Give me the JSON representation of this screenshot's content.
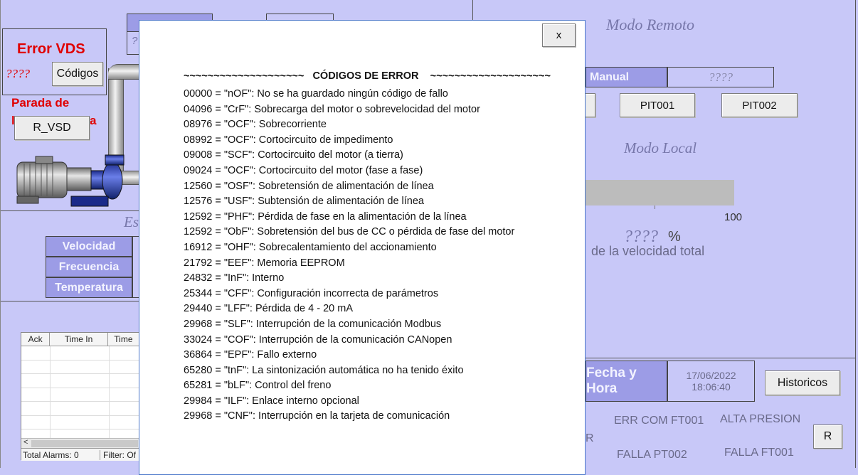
{
  "left_panel": {
    "error_title": "Error VDS",
    "error_value": "????",
    "codes_button": "Códigos",
    "stop_label_line1": "Parada de",
    "stop_label_partial": "a",
    "reset_vsd_button": "R_VSD",
    "top_box_partial": "?",
    "section_title_partial": "Es",
    "parameters": [
      {
        "label": "Velocidad"
      },
      {
        "label": "Frecuencia"
      },
      {
        "label": "Temperatura"
      }
    ]
  },
  "alarm_table": {
    "columns": [
      "Ack",
      "Time In",
      "Time"
    ],
    "scroll_left_glyph": "<",
    "total_alarms": "Total Alarms: 0",
    "filter_partial": "Filter: Of"
  },
  "right_panel": {
    "remote_mode_title": "Modo Remoto",
    "manual_label": "Manual",
    "manual_value": "????",
    "pit001_button": "PIT001",
    "pit002_button": "PIT002",
    "local_mode_title": "Modo Local",
    "scale_max": "100",
    "speed_value": "????",
    "speed_unit": "%",
    "speed_caption": "de la velocidad total",
    "speed_fraction": 0,
    "datetime_label": "Fecha y Hora",
    "date": "17/06/2022",
    "time": "18:06:40",
    "historicos_button": "Historicos",
    "alarm_err_com": "ERR COM FT001",
    "alarm_alta_presion": "ALTA PRESION",
    "alarm_partial": "R",
    "alarm_falla_pt002": "FALLA PT002",
    "alarm_falla_ft001": "FALLA FT001",
    "reset_button": "R"
  },
  "modal": {
    "close_label": "x",
    "title": "~~~~~~~~~~~~~~~~~~~~   CÓDIGOS DE ERROR    ~~~~~~~~~~~~~~~~~~~~",
    "codes": [
      "00000 = \"nOF\": No se ha guardado ningún código de fallo",
      "04096 = \"CrF\": Sobrecarga del motor o sobrevelocidad del motor",
      "08976 = \"OCF\": Sobrecorriente",
      "08992 = \"OCF\": Cortocircuito de impedimento",
      "09008 = \"SCF\": Cortocircuito del motor (a tierra)",
      "09024 = \"OCF\": Cortocircuito del motor (fase a fase)",
      "12560 = \"OSF\": Sobretensión de alimentación de línea",
      "12576 = \"USF\": Subtensión de alimentación de línea",
      "12592 = \"PHF\": Pérdida de fase en la alimentación de la línea",
      "12592 = \"ObF\": Sobretensión del bus de CC o pérdida de fase del motor",
      "16912 = \"OHF\": Sobrecalentamiento del accionamiento",
      "21792 = \"EEF\": Memoria EEPROM",
      "24832 = \"InF\": Interno",
      "25344 = \"CFF\": Configuración incorrecta de parámetros",
      "29440 = \"LFF\": Pérdida de 4 - 20 mA",
      "29968 = \"SLF\": Interrupción de la comunicación Modbus",
      "33024 = \"COF\": Interrupción de la comunicación CANopen",
      "36864 = \"EPF\": Fallo externo",
      "65280 = \"tnF\": La sintonización automática no ha tenido éxito",
      "65281 = \"bLF\": Control del freno",
      "29984 = \"ILF\": Enlace interno opcional",
      "29968 = \"CNF\": Interrupción en la tarjeta de comunicación"
    ]
  },
  "colors": {
    "background": "#c8c8f8",
    "error_red": "#e00000",
    "label_cell": "#9c9ce6",
    "modal_border": "#4a76c9"
  }
}
